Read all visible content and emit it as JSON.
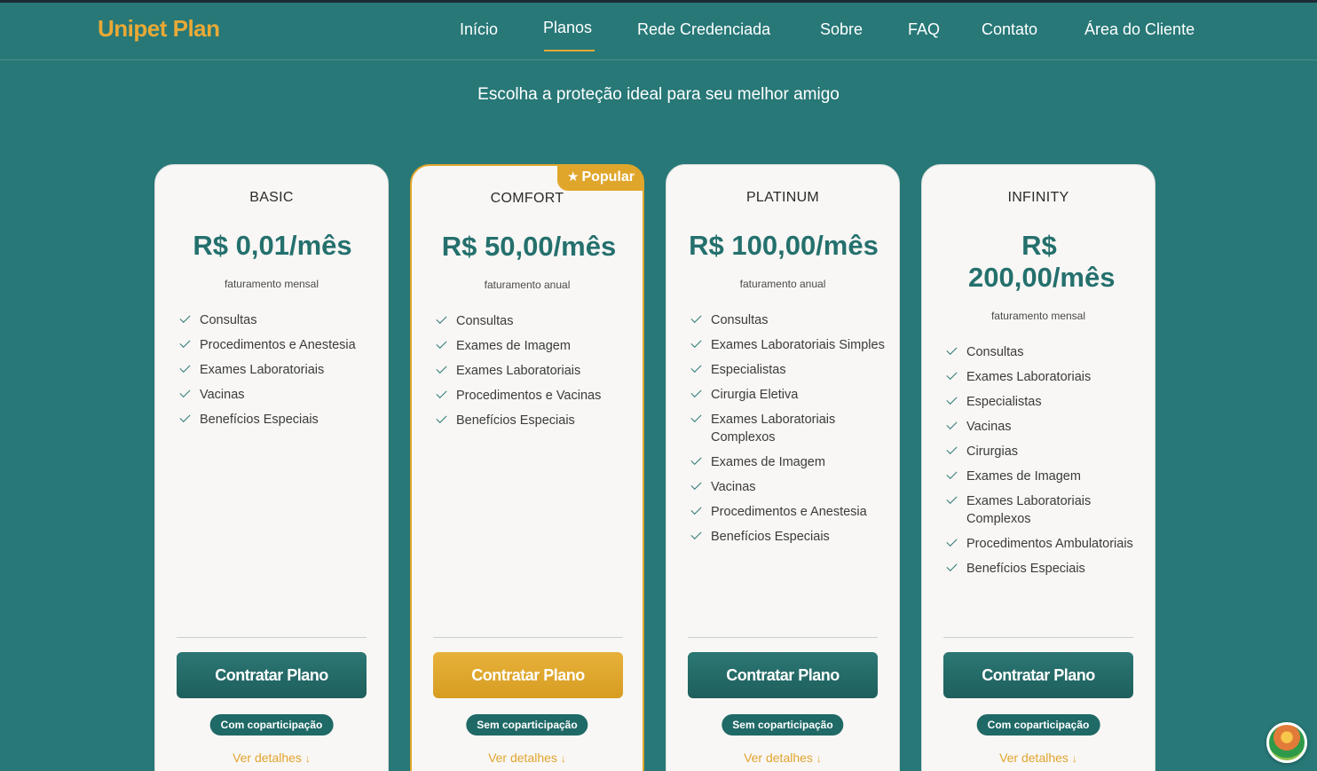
{
  "brand": {
    "logo": "Unipet Plan",
    "accent_color": "#e9a936",
    "primary_color": "#277877"
  },
  "nav": {
    "items": [
      {
        "label": "Início"
      },
      {
        "label": "Planos"
      },
      {
        "label": "Rede Credenciada"
      },
      {
        "label": "Sobre"
      },
      {
        "label": "FAQ"
      },
      {
        "label": "Contato"
      },
      {
        "label": "Área do Cliente"
      }
    ],
    "active": "Planos"
  },
  "hero": {
    "subtitle": "Escolha a proteção ideal para seu melhor amigo"
  },
  "plans": [
    {
      "name": "BASIC",
      "price": "R$ 0,01/mês",
      "billing": "faturamento mensal",
      "features": [
        "Consultas",
        "Procedimentos e Anestesia",
        "Exames Laboratoriais",
        "Vacinas",
        "Benefícios Especiais"
      ],
      "cta": "Contratar Plano",
      "badge": "Com coparticipação",
      "details": "Ver detalhes",
      "details_icon": "arrow-down-icon"
    },
    {
      "name": "COMFORT",
      "price": "R$ 50,00/mês",
      "billing": "faturamento anual",
      "popular": "Popular",
      "popular_icon": "star-icon",
      "features": [
        "Consultas",
        "Exames de Imagem",
        "Exames Laboratoriais",
        "Procedimentos e Vacinas",
        "Benefícios Especiais"
      ],
      "cta": "Contratar Plano",
      "badge": "Sem coparticipação",
      "details": "Ver detalhes",
      "details_icon": "arrow-down-icon"
    },
    {
      "name": "PLATINUM",
      "price": "R$ 100,00/mês",
      "billing": "faturamento anual",
      "features": [
        "Consultas",
        "Exames Laboratoriais Simples",
        "Especialistas",
        "Cirurgia Eletiva",
        "Exames Laboratoriais Complexos",
        "Exames de Imagem",
        "Vacinas",
        "Procedimentos e Anestesia",
        "Benefícios Especiais"
      ],
      "cta": "Contratar Plano",
      "badge": "Sem coparticipação",
      "details": "Ver detalhes",
      "details_icon": "arrow-down-icon"
    },
    {
      "name": "INFINITY",
      "price": "R$ 200,00/mês",
      "billing": "faturamento mensal",
      "features": [
        "Consultas",
        "Exames Laboratoriais",
        "Especialistas",
        "Vacinas",
        "Cirurgias",
        "Exames de Imagem",
        "Exames Laboratoriais Complexos",
        "Procedimentos Ambulatoriais",
        "Benefícios Especiais"
      ],
      "cta": "Contratar Plano",
      "badge": "Com coparticipação",
      "details": "Ver detalhes",
      "details_icon": "arrow-down-icon"
    }
  ]
}
